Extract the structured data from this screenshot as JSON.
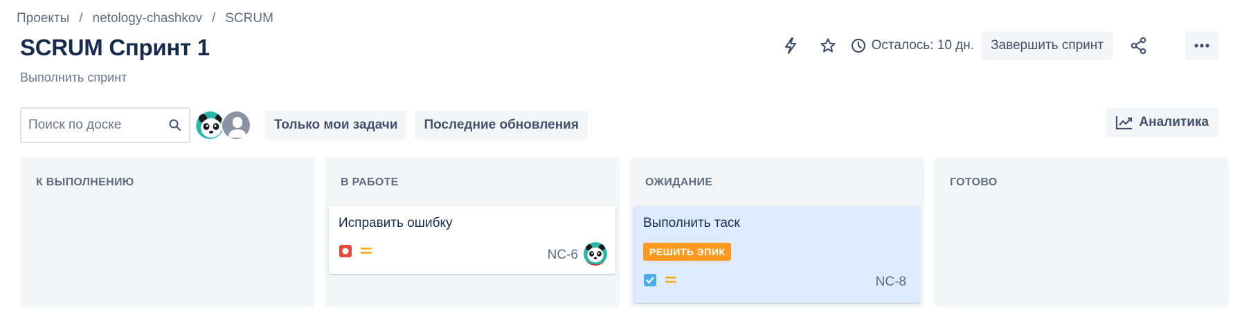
{
  "breadcrumb": {
    "items": [
      "Проекты",
      "netology-chashkov",
      "SCRUM"
    ],
    "separator": "/"
  },
  "page_title": "SCRUM Спринт 1",
  "sprint_goal": "Выполнить спринт",
  "header": {
    "time_remaining": "Осталось: 10 дн.",
    "complete_sprint_label": "Завершить спринт"
  },
  "toolbar": {
    "search_placeholder": "Поиск по доске",
    "filter_my_tasks": "Только мои задачи",
    "filter_recent": "Последние обновления",
    "analytics_label": "Аналитика"
  },
  "columns": [
    {
      "title": "К ВЫПОЛНЕНИЮ"
    },
    {
      "title": "В РАБОТЕ"
    },
    {
      "title": "ОЖИДАНИЕ"
    },
    {
      "title": "ГОТОВО"
    }
  ],
  "cards": [
    {
      "title": "Исправить ошибку",
      "key": "NC-6",
      "type_icon": "bug-icon",
      "priority_icon": "priority-medium-icon",
      "has_assignee": true
    },
    {
      "title": "Выполнить таск",
      "key": "NC-8",
      "epic": "РЕШИТЬ ЭПИК",
      "type_icon": "task-icon",
      "priority_icon": "priority-medium-icon",
      "selected": true
    }
  ],
  "colors": {
    "bug": "#e5493a",
    "task": "#4bade8",
    "priority_medium": "#ffab00",
    "epic_badge": "#ff991f",
    "selected_card": "#deebff",
    "column_bg": "#f4f5f7"
  }
}
